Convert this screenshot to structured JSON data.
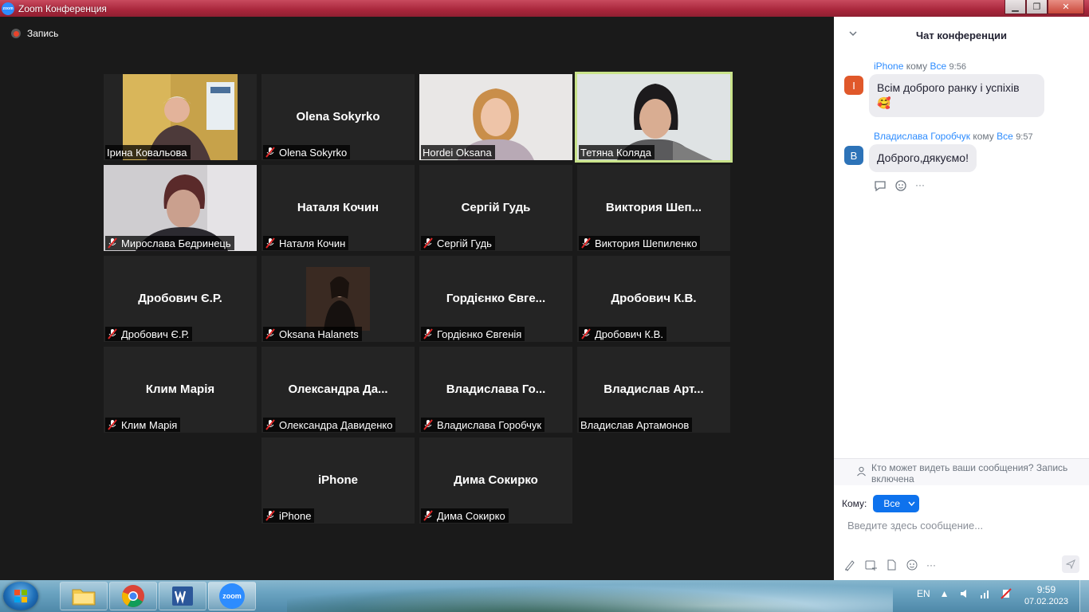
{
  "window": {
    "title": "Zoom Конференция",
    "controls": {
      "minimize": "▁",
      "maximize": "❐",
      "close": "✕"
    }
  },
  "recording": {
    "label": "Запись"
  },
  "tiles": [
    {
      "big": "",
      "label": "Ірина Ковальова",
      "muted": false,
      "video": "woman-red"
    },
    {
      "big": "Olena Sokyrko",
      "label": "Olena Sokyrko",
      "muted": true
    },
    {
      "big": "",
      "label": "Hordei Oksana",
      "muted": false,
      "video": "woman-blonde"
    },
    {
      "big": "",
      "label": "Тетяна Коляда",
      "muted": false,
      "video": "woman-dark",
      "active": true
    },
    {
      "big": "",
      "label": "Мирослава Бедринець",
      "muted": true,
      "video": "woman-older"
    },
    {
      "big": "Наталя Кочин",
      "label": "Наталя Кочин",
      "muted": true
    },
    {
      "big": "Сергій Гудь",
      "label": "Сергій Гудь",
      "muted": true
    },
    {
      "big": "Виктория  Шеп...",
      "label": "Виктория Шепиленко",
      "muted": true
    },
    {
      "big": "Дробович Є.Р.",
      "label": "Дробович Є.Р.",
      "muted": true
    },
    {
      "big": "",
      "label": "Oksana Halanets",
      "muted": true,
      "video": "photo-portrait"
    },
    {
      "big": "Гордієнко Євге...",
      "label": "Гордієнко Євгенія",
      "muted": true
    },
    {
      "big": "Дробович К.В.",
      "label": "Дробович К.В.",
      "muted": true
    },
    {
      "big": "Клим Марія",
      "label": "Клим Марія",
      "muted": true
    },
    {
      "big": "Олександра  Да...",
      "label": "Олександра Давиденко",
      "muted": true
    },
    {
      "big": "Владислава  Го...",
      "label": "Владислава Горобчук",
      "muted": true
    },
    {
      "big": "Владислав  Арт...",
      "label": "Владислав Артамонов",
      "muted": false
    },
    {
      "big": "iPhone",
      "label": "iPhone",
      "muted": true
    },
    {
      "big": "Дима Сокирко",
      "label": "Дима Сокирко",
      "muted": true
    }
  ],
  "chat": {
    "title": "Чат конференции",
    "messages": [
      {
        "sender": "iPhone",
        "to_word": "кому",
        "to": "Все",
        "time": "9:56",
        "avatar_letter": "I",
        "avatar_color": "#e0582a",
        "text": "Всім доброго ранку і успіхів",
        "emoji": "🥰"
      },
      {
        "sender": "Владислава Горобчук",
        "to_word": "кому",
        "to": "Все",
        "time": "9:57",
        "avatar_letter": "В",
        "avatar_color": "#2d73b8",
        "text": "Доброго,дякуємо!"
      }
    ],
    "notice": "Кто может видеть ваши сообщения? Запись включена",
    "to_label": "Кому:",
    "to_value": "Все",
    "input_placeholder": "Введите здесь сообщение...",
    "more": "···"
  },
  "taskbar": {
    "lang": "EN",
    "time": "9:59",
    "date": "07.02.2023",
    "zoom_label": "zoom"
  },
  "colors": {
    "accent": "#0e72ed",
    "active_speaker": "#c9e38a",
    "link": "#2d8cff"
  }
}
